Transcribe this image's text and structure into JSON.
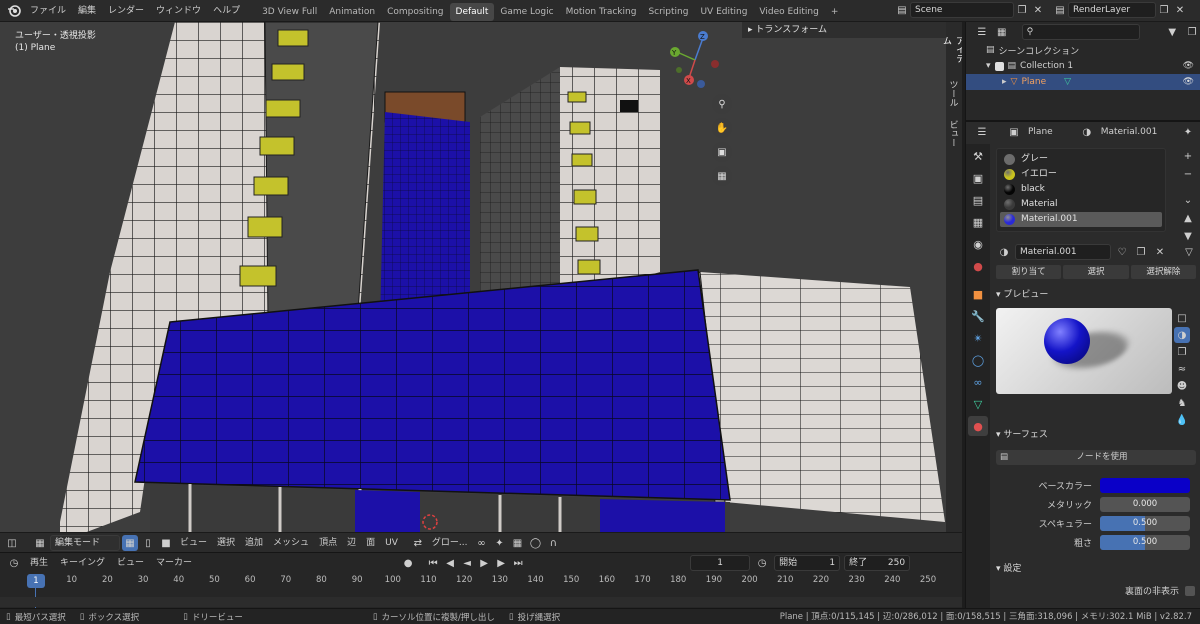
{
  "menu": [
    "ファイル",
    "編集",
    "レンダー",
    "ウィンドウ",
    "ヘルプ"
  ],
  "workspaces": [
    "3D View Full",
    "Animation",
    "Compositing",
    "Default",
    "Game Logic",
    "Motion Tracking",
    "Scripting",
    "UV Editing",
    "Video Editing"
  ],
  "active_workspace": "Default",
  "add_tab": "+",
  "scene": {
    "name": "Scene",
    "render_layer": "RenderLayer"
  },
  "viewport": {
    "view_label": "ユーザー・透視投影",
    "object_label": "(1) Plane",
    "n_panel_title": "トランスフォーム",
    "side_tabs": [
      "アイテム",
      "ツール",
      "ビュー"
    ],
    "gizmo_axes": {
      "z": "Z",
      "y": "Y",
      "x": "X"
    },
    "colors": {
      "background": "#3d3d3d",
      "glass": "#1c10a8",
      "wall": "#d9d4d0",
      "window": "#c4c22c",
      "roof": "#7a4a2a"
    }
  },
  "viewport_header": {
    "mode": "編集モード",
    "menus": [
      "ビュー",
      "選択",
      "追加",
      "メッシュ",
      "頂点",
      "辺",
      "面",
      "UV"
    ],
    "transform_orientation": "グロー..."
  },
  "outliner": {
    "root": "シーンコレクション",
    "collection": "Collection 1",
    "object": "Plane"
  },
  "properties": {
    "object_name": "Plane",
    "material_name": "Material.001",
    "materials": [
      {
        "name": "グレー",
        "color": "#6b6b6b"
      },
      {
        "name": "イエロー",
        "color": "#c8c21e"
      },
      {
        "name": "black",
        "color": "#050505"
      },
      {
        "name": "Material",
        "color": "#3a3a3a"
      },
      {
        "name": "Material.001",
        "color": "#2a2ad8"
      }
    ],
    "selected_material": "Material.001",
    "slot_buttons": [
      "割り当て",
      "選択",
      "選択解除"
    ],
    "preview_title": "プレビュー",
    "surface_title": "サーフェス",
    "use_nodes": "ノードを使用",
    "surface_fields": [
      {
        "label": "ベースカラー",
        "type": "color",
        "value": "#0a00c8"
      },
      {
        "label": "メタリック",
        "type": "number",
        "value": "0.000",
        "fraction": 0
      },
      {
        "label": "スペキュラー",
        "type": "number",
        "value": "0.500",
        "fraction": 0.5
      },
      {
        "label": "粗さ",
        "type": "number",
        "value": "0.500",
        "fraction": 0.5
      }
    ],
    "settings_title": "設定",
    "backface_label": "裏面の非表示"
  },
  "timeline": {
    "menus": [
      "再生",
      "キーイング",
      "ビュー",
      "マーカー"
    ],
    "current_frame": "1",
    "start_label": "開始",
    "start": "1",
    "end_label": "終了",
    "end": "250",
    "ruler": [
      "1",
      "10",
      "20",
      "30",
      "40",
      "50",
      "60",
      "70",
      "80",
      "90",
      "100",
      "110",
      "120",
      "130",
      "140",
      "150",
      "160",
      "170",
      "180",
      "190",
      "200",
      "210",
      "220",
      "230",
      "240",
      "250"
    ]
  },
  "statusbar": {
    "left": [
      "最短パス選択",
      "ボックス選択",
      "ドリービュー",
      "カーソル位置に複製/押し出し",
      "投げ縄選択"
    ],
    "right": "Plane | 頂点:0/115,145 | 辺:0/286,012 | 面:0/158,515 | 三角面:318,096 | メモリ:302.1 MiB | v2.82.7"
  }
}
